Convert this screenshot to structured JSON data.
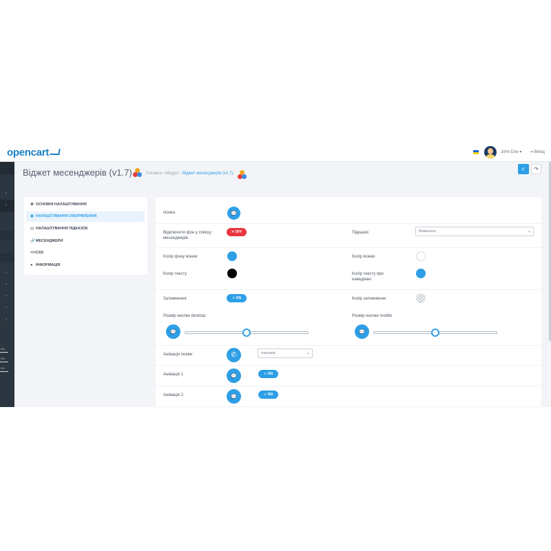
{
  "header": {
    "logo": "opencart",
    "user_name": "John Doe ▾",
    "logout_label": "⇥ Вихід"
  },
  "sidebar": {
    "badges": [
      "0%",
      "0%",
      "0%"
    ]
  },
  "page": {
    "title": "Віджет месенджерів (v1.7)",
    "breadcrumb": {
      "home": "Головна",
      "sep": "›",
      "modules": "Модулі",
      "current": "Віджет месенджерів (v1.7)"
    },
    "save_icon": "✓",
    "back_icon": "↷"
  },
  "tabs": [
    {
      "icon": "⚙",
      "label": "ОСНОВНІ НАЛАШТУВАННЯ"
    },
    {
      "icon": "◉",
      "label": "НАЛАШТУВАННЯ ОФОРМЛЕННЯ"
    },
    {
      "icon": "▭",
      "label": "НАЛАШТУВАННЯ ПІДКАЗОК"
    },
    {
      "icon": "🔗",
      "label": "МЕСЕНДЖЕРИ"
    },
    {
      "icon": "</>",
      "label": "CSS"
    },
    {
      "icon": "●",
      "label": "ІНФОРМАЦІЯ"
    }
  ],
  "form": {
    "icon_label": "Іконка",
    "disable_bg_label": "Відключити фон у списку месенджерів",
    "disable_bg_toggle": "✕ OFF",
    "hints_label": "Підказки",
    "hints_value": "Вимкнено",
    "icon_bg_color_label": "Колір фону іконки",
    "icon_bg_color": "#2e9fe6",
    "icon_color_label": "Колір іконки",
    "icon_color": "#ffffff",
    "text_color_label": "Колір тексту",
    "text_color": "#000000",
    "hover_text_color_label": "Колір тексту при наведенні",
    "hover_text_color": "#2e9fe6",
    "dimming_label": "Затемнення",
    "dimming_toggle": "✓ ON",
    "dimming_color_label": "Колір затемнення",
    "desktop_size_label": "Розмір кнопки desktop",
    "desktop_size_value": 0.5,
    "mobile_size_label": "Розмір кнопки mobile",
    "mobile_size_value": 0.5,
    "appear_anim_label": "Анімація появи",
    "appear_anim_value": "translate",
    "anim1_label": "Анімація 1",
    "anim1_toggle": "✓ ON",
    "anim2_label": "Анімація 2",
    "anim2_toggle": "✓ ON"
  },
  "icons": {
    "chat": "chat-icon",
    "phone": "phone-icon",
    "chat_glyph": "💬",
    "phone_glyph": "✆"
  },
  "colors": {
    "accent": "#2e9fe6",
    "danger": "#e8353f",
    "sidebar": "#2b3640"
  }
}
